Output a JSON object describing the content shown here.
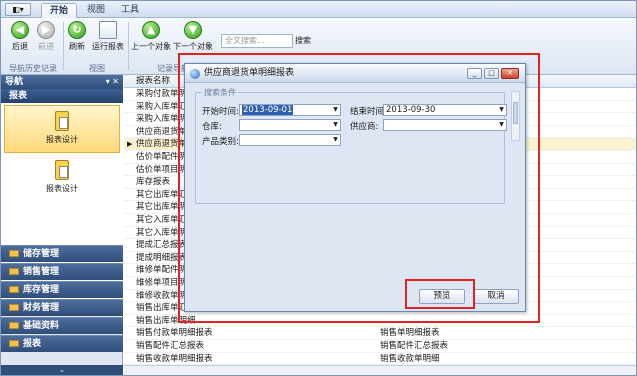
{
  "tabs": {
    "app_menu": "◧▾",
    "items": [
      "开始",
      "视图",
      "工具"
    ]
  },
  "ribbon": {
    "back": "后退",
    "forward": "前进",
    "refresh": "刷新",
    "run_report": "运行报表",
    "prev_object": "上一个对象",
    "next_object": "下一个对象",
    "search_placeholder": "全文搜索...",
    "search_button": "搜索",
    "groups": {
      "history": "导航历史记录",
      "view": "视图",
      "record": "记录导航"
    }
  },
  "nav": {
    "header": "导航",
    "pin": "▾ ✕",
    "section": "报表",
    "items": [
      {
        "label": "报表设计"
      },
      {
        "label": "报表设计"
      }
    ],
    "categories": [
      "储存管理",
      "销售管理",
      "库存管理",
      "财务管理",
      "基础资料",
      "报表"
    ],
    "more": "⌄"
  },
  "list": {
    "header": "报表名称",
    "rows": [
      {
        "c1": "采购付款单明细报表",
        "c2": ""
      },
      {
        "c1": "采购入库单汇总",
        "c2": ""
      },
      {
        "c1": "采购入库单明细",
        "c2": ""
      },
      {
        "c1": "供应商退货单汇",
        "c2": ""
      },
      {
        "c1": "供应商退货单明",
        "c2": ""
      },
      {
        "c1": "估价单配件明细",
        "c2": ""
      },
      {
        "c1": "估价单项目明细",
        "c2": ""
      },
      {
        "c1": "库存报表",
        "c2": ""
      },
      {
        "c1": "其它出库单汇总",
        "c2": ""
      },
      {
        "c1": "其它出库单明细",
        "c2": ""
      },
      {
        "c1": "其它入库单汇总",
        "c2": ""
      },
      {
        "c1": "其它入库单明细",
        "c2": ""
      },
      {
        "c1": "提成汇总报表",
        "c2": ""
      },
      {
        "c1": "提成明细报表",
        "c2": ""
      },
      {
        "c1": "维修单配件明细",
        "c2": ""
      },
      {
        "c1": "维修单项目明细",
        "c2": ""
      },
      {
        "c1": "维修收款单明细",
        "c2": ""
      },
      {
        "c1": "销售出库单汇总",
        "c2": ""
      },
      {
        "c1": "销售出库单明细",
        "c2": ""
      },
      {
        "c1": "销售付款单明细报表",
        "c2": "销售单明细报表"
      },
      {
        "c1": "销售配件汇总报表",
        "c2": "销售配件汇总报表"
      },
      {
        "c1": "销售收款单明细报表",
        "c2": "销售收款单明细"
      }
    ]
  },
  "dialog": {
    "title": "供应商退货单明细报表",
    "window_buttons": [
      "_",
      "□",
      "✕"
    ],
    "group_title": "搜索条件",
    "start_label": "开始时间:",
    "start_value": "2013-09-01",
    "end_label": "结束时间:",
    "end_value": "2013-09-30",
    "warehouse_label": "仓库:",
    "supplier_label": "供应商:",
    "category_label": "产品类别:",
    "preview": "预览",
    "cancel": "取消"
  },
  "colors": {
    "annotation_red": "#e02424",
    "selection_blue": "#3161ad",
    "nav_dark": "#2f4e7a"
  }
}
